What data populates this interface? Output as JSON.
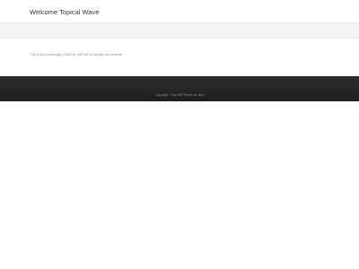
{
  "header": {
    "site_title": "Welcome Topical Wave"
  },
  "main": {
    "content_text": "This is your front page. Click the 'edit' link to change the contents."
  },
  "footer": {
    "copyright_text": "Copyright - GnuCMS Theme by Jack"
  },
  "colors": {
    "page_background": "#ffffff",
    "nav_bar": "#f3f3f3",
    "footer_background": "#262626",
    "title_text": "#333333",
    "muted_text": "#8a8a8a"
  }
}
